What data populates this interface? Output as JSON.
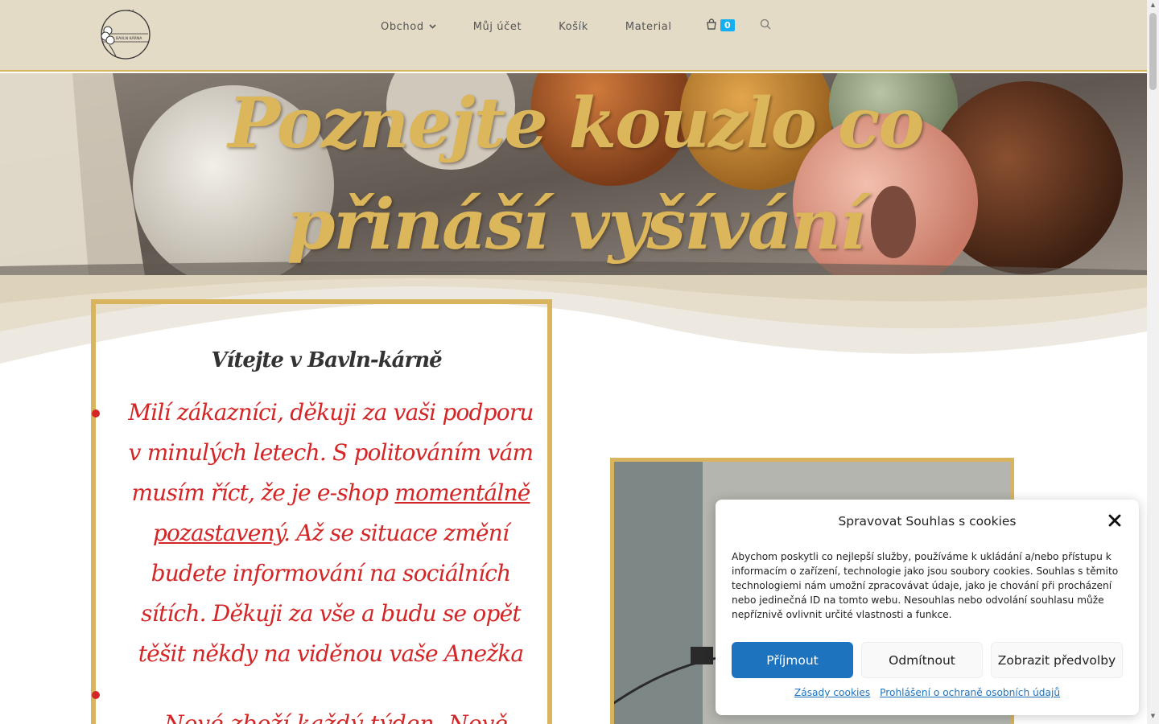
{
  "header": {
    "logo_text": "BAVLN KÁRNA",
    "nav": [
      {
        "label": "Obchod",
        "has_dropdown": true
      },
      {
        "label": "Můj účet"
      },
      {
        "label": "Košík"
      },
      {
        "label": "Material"
      }
    ],
    "cart_count": "0",
    "icons": {
      "cart": "shopping-bag-icon",
      "search": "search-icon",
      "dropdown": "chevron-down-icon"
    }
  },
  "hero": {
    "title": "Poznejte kouzlo co přináší vyšívání"
  },
  "welcome": {
    "title": "Vítejte v Bavln-kárně",
    "notice_part1": "Milí zákazníci, děkuji za vaši podporu v minulých letech. S politováním vám musím říct, že je e-shop ",
    "notice_underlined": "momentálně pozastavený",
    "notice_part2": ". Až se situace změní budete informování na sociálních sítích. Děkuji za vše a budu se opět těšit někdy na viděnou vaše Anežka",
    "notice2_partial": "Nové zboží každý týden. Nově..."
  },
  "cookie": {
    "title": "Spravovat Souhlas s cookies",
    "text": "Abychom poskytli co nejlepší služby, používáme k ukládání a/nebo přístupu k informacím o zařízení, technologie jako jsou soubory cookies. Souhlas s těmito technologiemi nám umožní zpracovávat údaje, jako je chování při procházení nebo jedinečná ID na tomto webu. Nesouhlas nebo odvolání souhlasu může nepříznivě ovlivnit určité vlastnosti a funkce.",
    "accept_label": "Příjmout",
    "deny_label": "Odmítnout",
    "prefs_label": "Zobrazit předvolby",
    "link_cookies": "Zásady cookies",
    "link_privacy": "Prohlášení o ochraně osobních údajů",
    "close_icon": "close-icon"
  },
  "colors": {
    "header_bg": "#e4dbc6",
    "gold": "#d9b45f",
    "notice_red": "#d42626",
    "accent_blue": "#1e73be",
    "badge_blue": "#13aff0"
  }
}
